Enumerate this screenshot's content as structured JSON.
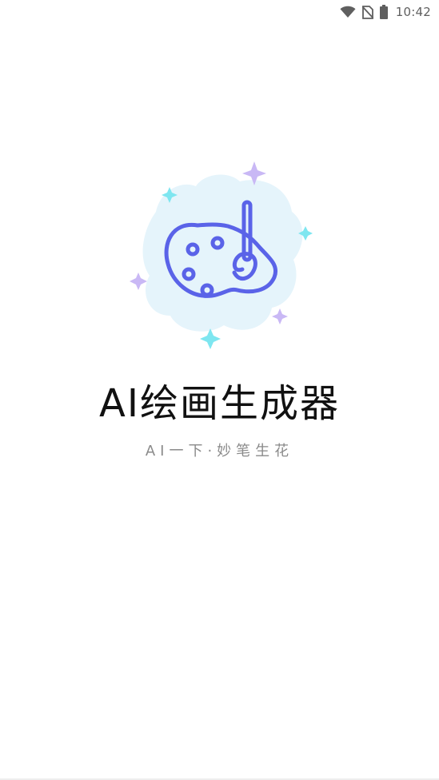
{
  "status_bar": {
    "time": "10:42",
    "icons": [
      "wifi-icon",
      "no-sim-icon",
      "battery-icon"
    ]
  },
  "splash": {
    "logo_icon": "palette-brush-icon",
    "title": "AI绘画生成器",
    "slogan": "AI一下·妙笔生花"
  },
  "colors": {
    "palette_stroke": "#5a63e8",
    "blob_fill": "#e5f4fb",
    "sparkle_cyan": "#7ee6f0",
    "sparkle_purple": "#c9b8f5",
    "title_text": "#111111",
    "slogan_text": "#8a8a8a"
  }
}
